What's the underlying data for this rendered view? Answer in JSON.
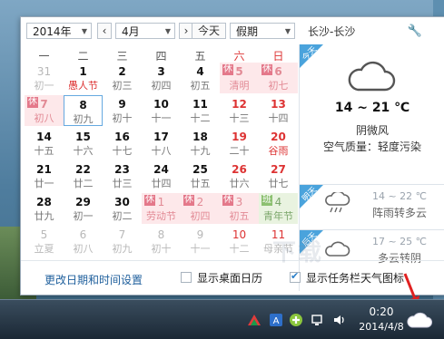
{
  "toolbar": {
    "year": "2014年",
    "month": "4月",
    "today_btn": "今天",
    "holiday": "假期",
    "city": "长沙-长沙"
  },
  "weekdays": [
    "一",
    "二",
    "三",
    "四",
    "五",
    "六",
    "日"
  ],
  "days": [
    {
      "d": "31",
      "s": "初一",
      "other": true
    },
    {
      "d": "1",
      "s": "愚人节",
      "fest": true
    },
    {
      "d": "2",
      "s": "初三"
    },
    {
      "d": "3",
      "s": "初四"
    },
    {
      "d": "4",
      "s": "初五"
    },
    {
      "d": "5",
      "s": "清明",
      "hol": true,
      "tag": "休"
    },
    {
      "d": "6",
      "s": "初七",
      "hol": true,
      "tag": "休"
    },
    {
      "d": "7",
      "s": "初八",
      "hol": true,
      "tag": "休"
    },
    {
      "d": "8",
      "s": "初九",
      "today": true
    },
    {
      "d": "9",
      "s": "初十"
    },
    {
      "d": "10",
      "s": "十一"
    },
    {
      "d": "11",
      "s": "十二"
    },
    {
      "d": "12",
      "s": "十三",
      "we": true
    },
    {
      "d": "13",
      "s": "十四",
      "we": true
    },
    {
      "d": "14",
      "s": "十五"
    },
    {
      "d": "15",
      "s": "十六"
    },
    {
      "d": "16",
      "s": "十七"
    },
    {
      "d": "17",
      "s": "十八"
    },
    {
      "d": "18",
      "s": "十九"
    },
    {
      "d": "19",
      "s": "二十",
      "we": true
    },
    {
      "d": "20",
      "s": "谷雨",
      "we": true,
      "fest": true
    },
    {
      "d": "21",
      "s": "廿一"
    },
    {
      "d": "22",
      "s": "廿二"
    },
    {
      "d": "23",
      "s": "廿三"
    },
    {
      "d": "24",
      "s": "廿四"
    },
    {
      "d": "25",
      "s": "廿五"
    },
    {
      "d": "26",
      "s": "廿六",
      "we": true
    },
    {
      "d": "27",
      "s": "廿七",
      "we": true
    },
    {
      "d": "28",
      "s": "廿九"
    },
    {
      "d": "29",
      "s": "初一"
    },
    {
      "d": "30",
      "s": "初二"
    },
    {
      "d": "1",
      "s": "劳动节",
      "hol": true,
      "tag": "休",
      "other": true
    },
    {
      "d": "2",
      "s": "初四",
      "hol": true,
      "tag": "休",
      "other": true
    },
    {
      "d": "3",
      "s": "初五",
      "hol": true,
      "tag": "休",
      "other": true
    },
    {
      "d": "4",
      "s": "青年节",
      "work": true,
      "tag": "班",
      "other": true
    },
    {
      "d": "5",
      "s": "立夏",
      "other": true
    },
    {
      "d": "6",
      "s": "初八",
      "other": true
    },
    {
      "d": "7",
      "s": "初九",
      "other": true
    },
    {
      "d": "8",
      "s": "初十",
      "other": true
    },
    {
      "d": "9",
      "s": "十一",
      "other": true
    },
    {
      "d": "10",
      "s": "十二",
      "other": true
    },
    {
      "d": "11",
      "s": "母亲节",
      "other": true
    }
  ],
  "weather": {
    "today_ribbon": "今天",
    "today_temp": "14 ~ 21 ℃",
    "today_cond": "阴微风",
    "today_aqi": "空气质量：轻度污染",
    "forecast": [
      {
        "ribbon": "明天",
        "temp": "14 ~ 22 ℃",
        "cond": "阵雨转多云",
        "icon": "rain-cloud-icon"
      },
      {
        "ribbon": "后天",
        "temp": "17 ~ 25 ℃",
        "cond": "多云转阴",
        "icon": "cloud-icon"
      }
    ]
  },
  "footer": {
    "settings_link": "更改日期和时间设置",
    "show_desktop": "显示桌面日历",
    "show_tray": "显示任务栏天气图标",
    "show_desktop_checked": false,
    "show_tray_checked": true
  },
  "taskbar": {
    "time": "0:20",
    "date": "2014/4/8"
  },
  "colors": {
    "accent": "#4aa3dc",
    "holiday_bg": "#fde8ea",
    "weekend_red": "#dd3333"
  }
}
